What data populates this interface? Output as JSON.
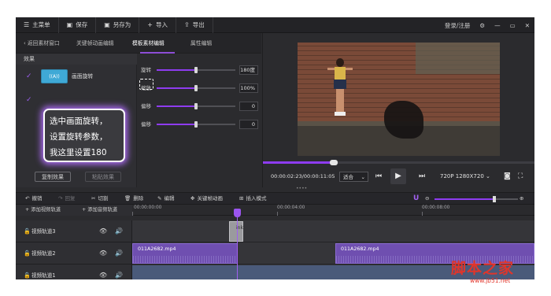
{
  "menubar": {
    "main_menu": "主菜单",
    "save": "保存",
    "save_as": "另存为",
    "import": "导入",
    "export": "导出",
    "login": "登录/注册"
  },
  "tabs": {
    "back": "返回素材窗口",
    "keyframe": "关键帧动画编辑",
    "template": "模板素材编辑",
    "property": "属性编辑"
  },
  "effects": {
    "header": "效果",
    "item_label": "画面旋转",
    "thumb_text": "((A))",
    "copy_button": "复制效果",
    "paste_button": "粘贴效果"
  },
  "properties": [
    {
      "label": "旋转",
      "value": "180度",
      "fill": 0.5
    },
    {
      "label": "缩放",
      "value": "100%",
      "fill": 0.5
    },
    {
      "label": "偏移",
      "value": "0",
      "fill": 0.5
    },
    {
      "label": "偏移",
      "value": "0",
      "fill": 0.5
    }
  ],
  "callout": {
    "line1": "选中画面旋转，",
    "line2": "设置旋转参数，",
    "line3": "我这里设置180"
  },
  "preview": {
    "timecode": "00:00:02:23/00:00:11:05",
    "fit": "适合",
    "resolution": "720P 1280X720",
    "progress": 0.26
  },
  "toolbar": {
    "undo": "撤销",
    "redo": "回复",
    "cut": "切割",
    "delete": "删除",
    "edit": "编辑",
    "keyframe": "关键帧动画",
    "insert_mode": "插入模式",
    "zoom": 0.72
  },
  "timeline": {
    "add_video_track": "添加视频轨道",
    "add_audio_track": "添加音频轨道",
    "ruler": [
      "00:00:00:00",
      "00:00:04:00",
      "00:00:08:00"
    ],
    "tracks": [
      {
        "name": "视频轨道3",
        "clip_text": "ink"
      },
      {
        "name": "视频轨道2",
        "clip1": "011A2682.mp4",
        "clip2": "011A2682.mp4"
      },
      {
        "name": "视频轨道1"
      }
    ]
  },
  "watermark": {
    "brand": "脚本之家",
    "url": "www.jb51.net"
  },
  "colors": {
    "accent": "#8e3cf0",
    "app_bg": "#2b2b2e",
    "watermark": "#e0352b"
  }
}
